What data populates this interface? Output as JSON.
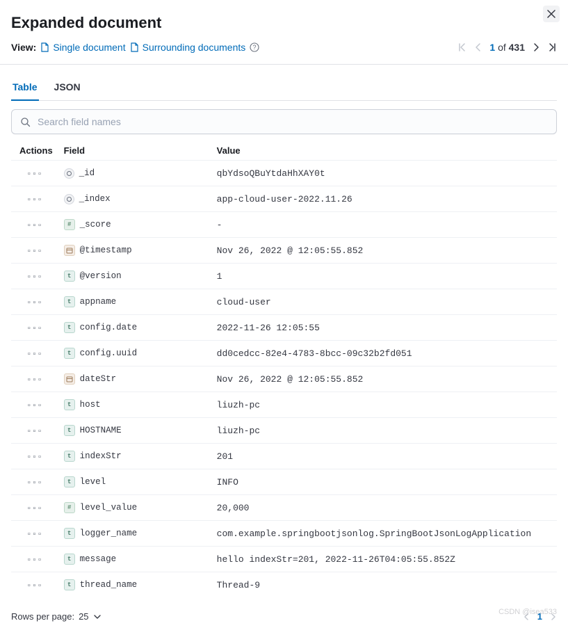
{
  "header": {
    "title": "Expanded document",
    "view_label": "View:",
    "single_doc": "Single document",
    "surrounding": "Surrounding documents"
  },
  "pager": {
    "current": "1",
    "of": "of",
    "total": "431"
  },
  "tabs": {
    "table": "Table",
    "json": "JSON"
  },
  "search": {
    "placeholder": "Search field names"
  },
  "columns": {
    "actions": "Actions",
    "field": "Field",
    "value": "Value"
  },
  "rows": [
    {
      "type": "id",
      "field": "_id",
      "value": "qbYdsoQBuYtdaHhXAY0t"
    },
    {
      "type": "id",
      "field": "_index",
      "value": "app-cloud-user-2022.11.26"
    },
    {
      "type": "hash",
      "field": "_score",
      "value": " - ",
      "empty": true
    },
    {
      "type": "date",
      "field": "@timestamp",
      "value": "Nov 26, 2022 @ 12:05:55.852"
    },
    {
      "type": "t",
      "field": "@version",
      "value": "1"
    },
    {
      "type": "t",
      "field": "appname",
      "value": "cloud-user"
    },
    {
      "type": "t",
      "field": "config.date",
      "value": "2022-11-26 12:05:55"
    },
    {
      "type": "t",
      "field": "config.uuid",
      "value": "dd0cedcc-82e4-4783-8bcc-09c32b2fd051"
    },
    {
      "type": "date",
      "field": "dateStr",
      "value": "Nov 26, 2022 @ 12:05:55.852"
    },
    {
      "type": "t",
      "field": "host",
      "value": "liuzh-pc"
    },
    {
      "type": "t",
      "field": "HOSTNAME",
      "value": "liuzh-pc"
    },
    {
      "type": "t",
      "field": "indexStr",
      "value": "201"
    },
    {
      "type": "t",
      "field": "level",
      "value": "INFO"
    },
    {
      "type": "hash",
      "field": "level_value",
      "value": "20,000"
    },
    {
      "type": "t",
      "field": "logger_name",
      "value": "com.example.springbootjsonlog.SpringBootJsonLogApplication"
    },
    {
      "type": "t",
      "field": "message",
      "value": "hello indexStr=201, 2022-11-26T04:05:55.852Z"
    },
    {
      "type": "t",
      "field": "thread_name",
      "value": "Thread-9"
    }
  ],
  "footer": {
    "rows_label": "Rows per page:",
    "rows_value": "25",
    "page": "1"
  },
  "icons": {
    "t": "t",
    "hash": "#",
    "date": "📅",
    "id": "◯"
  },
  "watermark": "CSDN @isea533"
}
